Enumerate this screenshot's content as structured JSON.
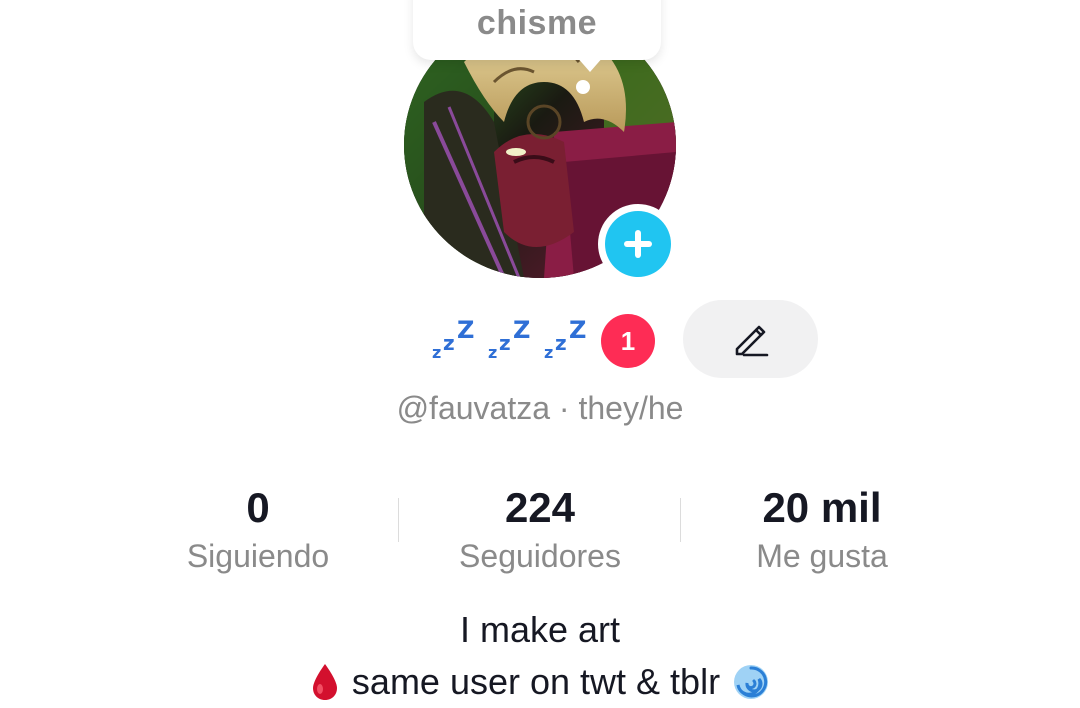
{
  "bubble": {
    "text": "chisme"
  },
  "profile": {
    "display_name_icon": "zzz-sleeping-emoji",
    "notification_count": "1",
    "handle": "@fauvatza · they/he"
  },
  "stats": [
    {
      "value": "0",
      "label": "Siguiendo"
    },
    {
      "value": "224",
      "label": "Seguidores"
    },
    {
      "value": "20 mil",
      "label": "Me gusta"
    }
  ],
  "bio": {
    "line1": "I make art",
    "line2": "same user on twt & tblr",
    "line2_left_icon": "drop-of-blood-icon",
    "line2_right_icon": "cyclone-icon"
  },
  "colors": {
    "add_button": "#20c5f1",
    "badge": "#fe2c55",
    "text_primary": "#161823",
    "text_secondary": "#8a8a8a",
    "edit_button_bg": "#f1f1f2",
    "zzz": "#2f6fd6"
  }
}
